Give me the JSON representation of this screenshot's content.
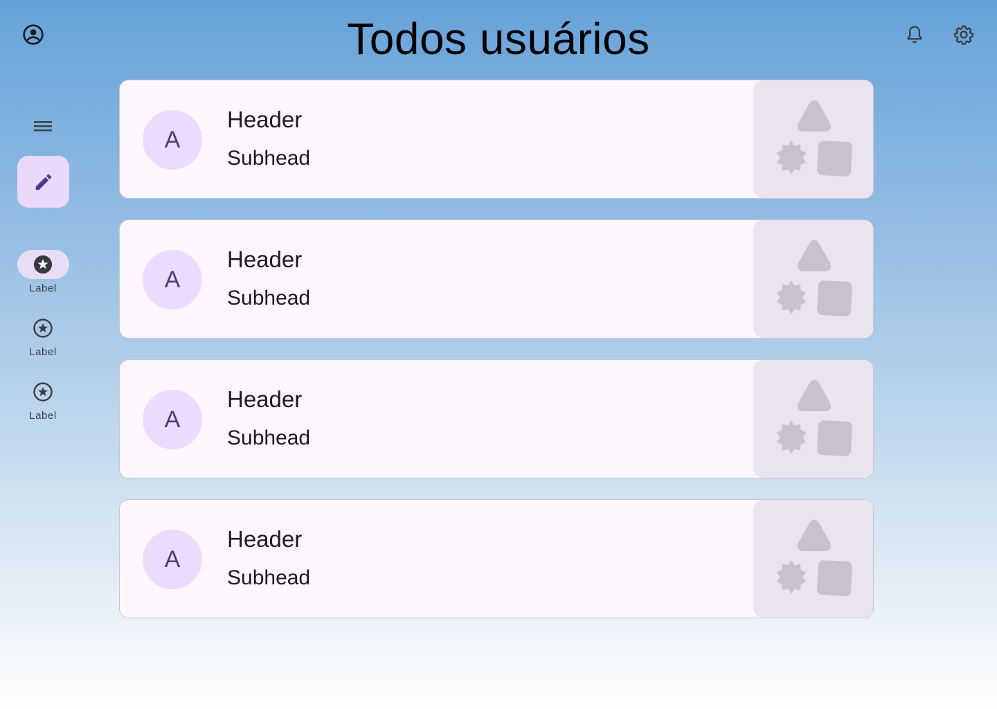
{
  "topbar": {
    "account_icon": "account-circle-icon",
    "title": "Todos usuários",
    "notifications_icon": "bell-icon",
    "settings_icon": "gear-icon"
  },
  "rail": {
    "menu_icon": "menu-icon",
    "fab_icon": "pencil-icon",
    "items": [
      {
        "label": "Label",
        "icon": "star-circle-icon",
        "active": true
      },
      {
        "label": "Label",
        "icon": "star-circle-icon",
        "active": false
      },
      {
        "label": "Label",
        "icon": "star-circle-icon",
        "active": false
      }
    ]
  },
  "cards": [
    {
      "avatar": "A",
      "header": "Header",
      "subhead": "Subhead",
      "media_icon": "shapes-placeholder-icon"
    },
    {
      "avatar": "A",
      "header": "Header",
      "subhead": "Subhead",
      "media_icon": "shapes-placeholder-icon"
    },
    {
      "avatar": "A",
      "header": "Header",
      "subhead": "Subhead",
      "media_icon": "shapes-placeholder-icon"
    },
    {
      "avatar": "A",
      "header": "Header",
      "subhead": "Subhead",
      "media_icon": "shapes-placeholder-icon"
    }
  ],
  "colors": {
    "card_background": "#fdf7fd",
    "avatar_background": "#eadcfc",
    "avatar_text": "#4d3a7c",
    "fab_background": "#ead9fb",
    "media_background": "#e9e4ee",
    "media_shapes": "#c9c1cf"
  }
}
